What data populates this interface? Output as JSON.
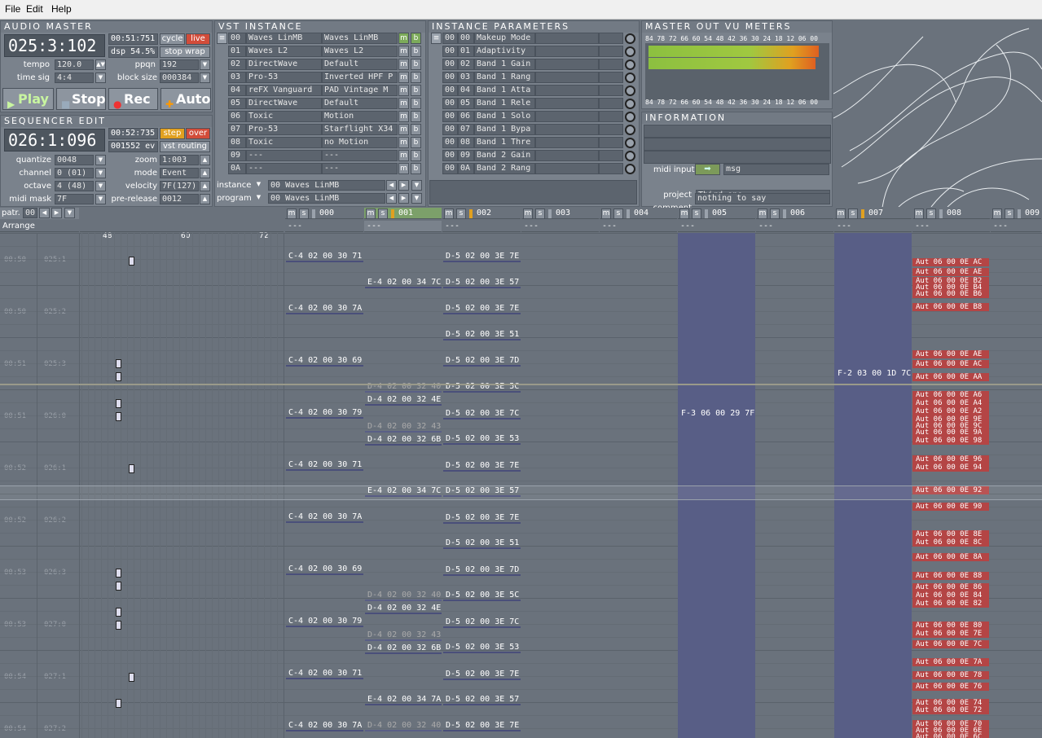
{
  "menu": {
    "file": "File",
    "edit": "Edit",
    "help": "Help"
  },
  "audio_master": {
    "title": "AUDIO MASTER",
    "position": "025:3:102",
    "time": "00:51:751",
    "cycle": "cycle",
    "live": "live",
    "dsp": "dsp 54.5%",
    "stop_wrap": "stop wrap",
    "tempo_label": "tempo",
    "tempo": "120.0",
    "ppqn_label": "ppqn",
    "ppqn": "192",
    "timesig_label": "time sig",
    "timesig": "4:4",
    "blocksize_label": "block size",
    "blocksize": "000384"
  },
  "transport": {
    "play": "Play",
    "stop": "Stop",
    "rec": "Rec",
    "auto": "Auto"
  },
  "seq_edit": {
    "title": "SEQUENCER EDIT",
    "position": "026:1:096",
    "time": "00:52:735",
    "step": "step",
    "over": "over",
    "events": "001552 ev",
    "vst_routing": "vst routing",
    "rows": [
      {
        "l": "quantize",
        "v": "0048",
        "l2": "zoom",
        "v2": "1:003"
      },
      {
        "l": "channel",
        "v": "0 (01)",
        "l2": "mode",
        "v2": "Event"
      },
      {
        "l": "octave",
        "v": "4 (48)",
        "l2": "velocity",
        "v2": "7F(127)"
      },
      {
        "l": "midi mask",
        "v": "7F",
        "l2": "pre-release",
        "v2": "0012"
      }
    ]
  },
  "vst": {
    "title": "VST INSTANCE",
    "rows": [
      {
        "n": "00",
        "a": "Waves LinMB",
        "b": "Waves LinMB"
      },
      {
        "n": "01",
        "a": "Waves L2",
        "b": "Waves L2"
      },
      {
        "n": "02",
        "a": "DirectWave",
        "b": "Default"
      },
      {
        "n": "03",
        "a": "Pro-53",
        "b": "Inverted HPF P"
      },
      {
        "n": "04",
        "a": "reFX Vanguard",
        "b": "PAD Vintage  M"
      },
      {
        "n": "05",
        "a": "DirectWave",
        "b": "Default"
      },
      {
        "n": "06",
        "a": "Toxic",
        "b": "Motion"
      },
      {
        "n": "07",
        "a": "Pro-53",
        "b": "Starflight X34"
      },
      {
        "n": "08",
        "a": "Toxic",
        "b": "no Motion"
      },
      {
        "n": "09",
        "a": "---",
        "b": "---"
      },
      {
        "n": "0A",
        "a": "---",
        "b": "---"
      }
    ],
    "m": "m",
    "b_": "b",
    "instance_label": "instance",
    "program_label": "program",
    "instance_num": "00",
    "instance_name": "Waves LinMB",
    "program_num": "00",
    "program_name": "Waves LinMB"
  },
  "params": {
    "title": "INSTANCE PARAMETERS",
    "rows": [
      {
        "a": "00",
        "b": "00",
        "n": "Makeup Mode"
      },
      {
        "a": "00",
        "b": "01",
        "n": "Adaptivity"
      },
      {
        "a": "00",
        "b": "02",
        "n": "Band 1 Gain"
      },
      {
        "a": "00",
        "b": "03",
        "n": "Band 1 Rang"
      },
      {
        "a": "00",
        "b": "04",
        "n": "Band 1 Atta"
      },
      {
        "a": "00",
        "b": "05",
        "n": "Band 1 Rele"
      },
      {
        "a": "00",
        "b": "06",
        "n": "Band 1 Solo"
      },
      {
        "a": "00",
        "b": "07",
        "n": "Band 1 Bypa"
      },
      {
        "a": "00",
        "b": "08",
        "n": "Band 1 Thre"
      },
      {
        "a": "00",
        "b": "09",
        "n": "Band 2 Gain"
      },
      {
        "a": "00",
        "b": "0A",
        "n": "Band 2 Rang"
      }
    ]
  },
  "vu": {
    "title": "MASTER OUT VU METERS",
    "scale": "84 78 72 66 60 54 48 42 36 30 24 18 12 06 00",
    "level_l": 0.96,
    "level_r": 0.94
  },
  "info": {
    "title": "INFORMATION",
    "midi_input": "midi input",
    "msg": "msg",
    "project_label": "project",
    "project": "Third one",
    "comment_label": "comment",
    "comment": "nothing to say"
  },
  "seq": {
    "patr_label": "patr.",
    "patr": "00",
    "arrange": "Arrange",
    "ruler": [
      "48",
      "60",
      "72"
    ],
    "dash": "---",
    "tracks": [
      "000",
      "001",
      "002",
      "003",
      "004",
      "005",
      "006",
      "007",
      "008",
      "009"
    ],
    "times": [
      {
        "t": "00:50",
        "p": "025:1"
      },
      {
        "t": "00:50",
        "p": "025:2"
      },
      {
        "t": "00:51",
        "p": "025:3"
      },
      {
        "t": "00:51",
        "p": "026:0"
      },
      {
        "t": "00:52",
        "p": "026:1"
      },
      {
        "t": "00:52",
        "p": "026:2"
      },
      {
        "t": "00:53",
        "p": "026:3"
      },
      {
        "t": "00:53",
        "p": "027:0"
      },
      {
        "t": "00:54",
        "p": "027:1"
      },
      {
        "t": "00:54",
        "p": "027:2"
      }
    ],
    "t000": [
      "C-4 02 00 30 71",
      "C-4 02 00 30 7A",
      "C-4 02 00 30 69",
      "C-4 02 00 30 79",
      "C-4 02 00 30 71",
      "C-4 02 00 30 7A",
      "C-4 02 00 30 69",
      "C-4 02 00 30 79",
      "C-4 02 00 30 71",
      "C-4 02 00 30 7A"
    ],
    "t001": [
      "E-4 02 00 34 7C",
      "D-4 02 00 32 40",
      "D-4 02 00 32 4E",
      "D-4 02 00 32 43",
      "D-4 02 00 32 6B",
      "E-4 02 00 34 7C",
      "D-4 02 00 32 40",
      "D-4 02 00 32 4E",
      "D-4 02 00 32 43",
      "D-4 02 00 32 6B",
      "E-4 02 00 34 7A",
      "D-4 02 00 32 40"
    ],
    "t002": [
      "D-5 02 00 3E 7E",
      "D-5 02 00 3E 57",
      "D-5 02 00 3E 7E",
      "D-5 02 00 3E 51",
      "D-5 02 00 3E 7D",
      "D-5 02 00 3E 5C",
      "D-5 02 00 3E 7C",
      "D-5 02 00 3E 53",
      "D-5 02 00 3E 7E",
      "D-5 02 00 3E 57",
      "D-5 02 00 3E 7E",
      "D-5 02 00 3E 51",
      "D-5 02 00 3E 7D",
      "D-5 02 00 3E 5C",
      "D-5 02 00 3E 7C",
      "D-5 02 00 3E 53",
      "D-5 02 00 3E 7E",
      "D-5 02 00 3E 57",
      "D-5 02 00 3E 7E"
    ],
    "t005": "F-3 06 00 29 7F",
    "t007": "F-2 03 00 1D 7C",
    "t008": [
      "Aut 06 00 0E AC",
      "Aut 06 00 0E AE",
      "Aut 06 00 0E B2",
      "Aut 06 00 0E B4",
      "Aut 06 00 0E B6",
      "Aut 06 00 0E B8",
      "Aut 06 00 0E AE",
      "Aut 06 00 0E AC",
      "Aut 06 00 0E AA",
      "Aut 06 00 0E A6",
      "Aut 06 00 0E A4",
      "Aut 06 00 0E A2",
      "Aut 06 00 0E 9E",
      "Aut 06 00 0E 9C",
      "Aut 06 00 0E 9A",
      "Aut 06 00 0E 98",
      "Aut 06 00 0E 96",
      "Aut 06 00 0E 94",
      "Aut 06 00 0E 92",
      "Aut 06 00 0E 90",
      "Aut 06 00 0E 8E",
      "Aut 06 00 0E 8C",
      "Aut 06 00 0E 8A",
      "Aut 06 00 0E 88",
      "Aut 06 00 0E 86",
      "Aut 06 00 0E 84",
      "Aut 06 00 0E 82",
      "Aut 06 00 0E 80",
      "Aut 06 00 0E 7E",
      "Aut 06 00 0E 7C",
      "Aut 06 00 0E 7A",
      "Aut 06 00 0E 78",
      "Aut 06 00 0E 76",
      "Aut 06 00 0E 74",
      "Aut 06 00 0E 72",
      "Aut 06 00 0E 70",
      "Aut 06 00 0E 6E",
      "Aut 06 00 0E 6C"
    ]
  }
}
